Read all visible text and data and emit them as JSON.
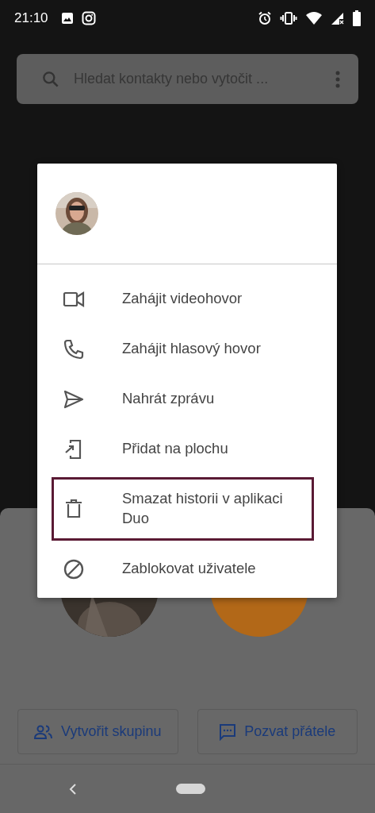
{
  "status_bar": {
    "time": "21:10"
  },
  "search": {
    "placeholder": "Hledat kontakty nebo vytočit ..."
  },
  "dialog": {
    "items": [
      {
        "kind": "video",
        "label": "Zahájit videohovor",
        "highlighted": false
      },
      {
        "kind": "phone",
        "label": "Zahájit hlasový hovor",
        "highlighted": false
      },
      {
        "kind": "send",
        "label": "Nahrát zprávu",
        "highlighted": false
      },
      {
        "kind": "home",
        "label": "Přidat na plochu",
        "highlighted": false
      },
      {
        "kind": "trash",
        "label": "Smazat historii v aplikaci Duo",
        "highlighted": true
      },
      {
        "kind": "block",
        "label": "Zablokovat uživatele",
        "highlighted": false
      }
    ]
  },
  "buttons": [
    {
      "kind": "group",
      "label": "Vytvořit skupinu"
    },
    {
      "kind": "invite",
      "label": "Pozvat přátele"
    }
  ]
}
